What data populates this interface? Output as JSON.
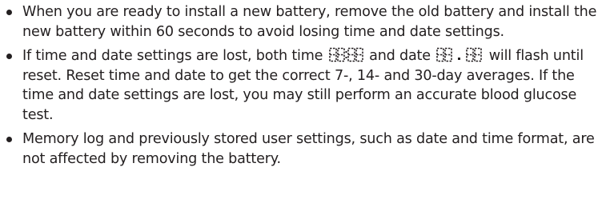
{
  "document": {
    "bullets": [
      {
        "text": "When you are ready to install a new battery, remove the old battery and install the new battery within 60 seconds to avoid losing time and date settings."
      },
      {
        "text_a": "If time and date settings are lost, both time ",
        "time_display": "00:00",
        "text_b": " and date ",
        "date_display": "00.00",
        "text_c": " will flash until reset. Reset time and date to get the correct 7-, 14- and 30-day averages. If the time and date settings are lost, you may still perform an accurate blood glucose test."
      },
      {
        "text": "Memory log and previously stored user settings, such as date and time format, are not affected by removing the battery."
      }
    ],
    "icons": {
      "bullet": "bullet-dot-icon",
      "time": "time-segment-display-icon",
      "date": "date-segment-display-icon"
    },
    "colors": {
      "text": "#231f20",
      "background": "#ffffff"
    }
  }
}
